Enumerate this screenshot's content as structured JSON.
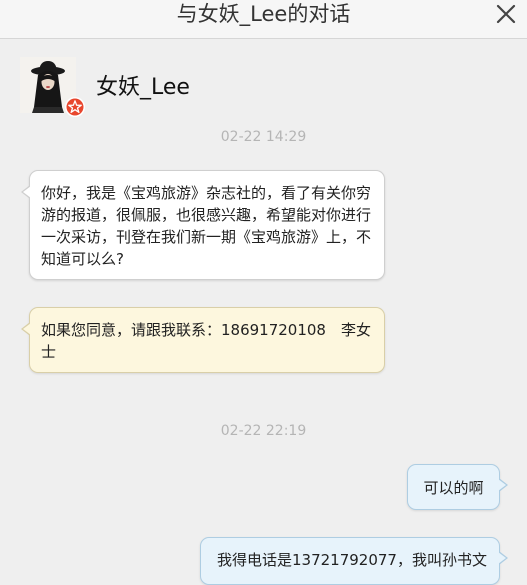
{
  "header": {
    "title": "与女妖_Lee的对话",
    "close_icon": "close-icon"
  },
  "contact": {
    "name": "女妖_Lee",
    "avatar_icon": "avatar",
    "badge_icon": "verified-badge-icon"
  },
  "messages": [
    {
      "type": "timestamp",
      "text": "02-22 14:29"
    },
    {
      "type": "incoming",
      "text": "你好，我是《宝鸡旅游》杂志社的，看了有关你穷游的报道，很佩服，也很感兴趣，希望能对你进行一次采访，刊登在我们新一期《宝鸡旅游》上，不知道可以么?"
    },
    {
      "type": "incoming",
      "text": "如果您同意，请跟我联系：18691720108　李女士"
    },
    {
      "type": "timestamp",
      "text": "02-22 22:19"
    },
    {
      "type": "outgoing",
      "text": "可以的啊"
    },
    {
      "type": "outgoing",
      "text": "我得电话是13721792077，我叫孙书文"
    }
  ],
  "colors": {
    "background": "#efefef",
    "incoming_bubble": "#ffffff",
    "contact_info_bubble": "#fdf7de",
    "outgoing_bubble": "#e7f3fb",
    "badge": "#e8462d",
    "timestamp": "#b5b5b5"
  }
}
